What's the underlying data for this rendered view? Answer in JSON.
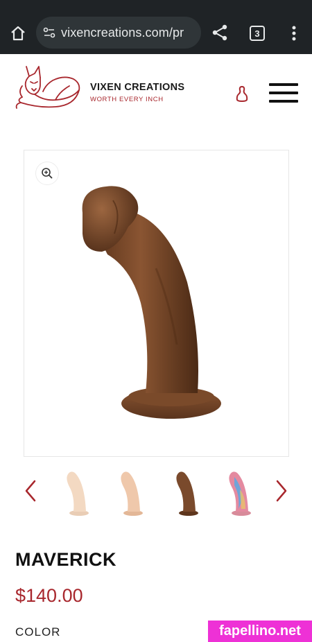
{
  "browser": {
    "url": "vixencreations.com/pr",
    "tab_count": "3",
    "icons": [
      "home-icon",
      "site-info-icon",
      "share-icon",
      "tabs-icon",
      "more-vert-icon"
    ]
  },
  "header": {
    "brand_name": "VIXEN CREATIONS",
    "tagline": "WORTH EVERY INCH",
    "brand_color": "#a8272d",
    "icons": [
      "fox-logo",
      "account-icon",
      "hamburger-menu-icon"
    ]
  },
  "gallery": {
    "zoom_icon": "zoom-in-icon",
    "thumbnails": [
      {
        "name": "vanilla",
        "color": "#f3d9c2"
      },
      {
        "name": "peach",
        "color": "#efc8ab"
      },
      {
        "name": "chocolate",
        "color": "#7a4a2c"
      },
      {
        "name": "multicolor",
        "color": "#c9a3a8"
      }
    ],
    "selected_index": 2
  },
  "product": {
    "title": "MAVERICK",
    "price": "$140.00",
    "option_label": "COLOR"
  },
  "watermark": {
    "text": "fapellino.net",
    "color": "#ee31d6"
  }
}
